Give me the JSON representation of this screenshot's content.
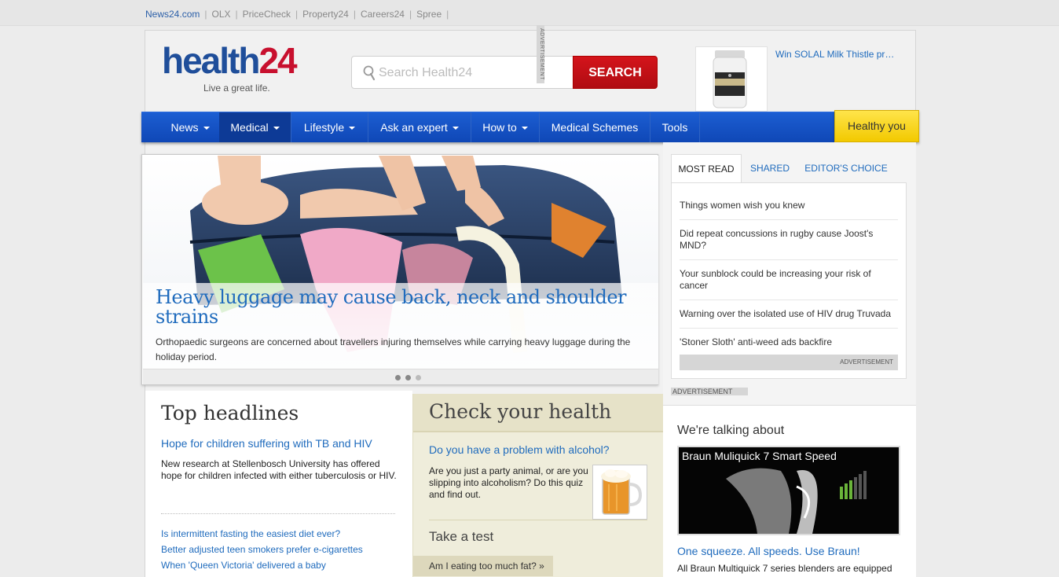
{
  "network": {
    "links": [
      "News24.com",
      "OLX",
      "PriceCheck",
      "Property24",
      "Careers24",
      "Spree"
    ]
  },
  "logo": {
    "word_a": "health",
    "word_b": "24",
    "tagline": "Live a great life."
  },
  "search": {
    "placeholder": "Search Health24",
    "button": "SEARCH"
  },
  "advertisement_tag": "ADVERTISEMENT",
  "top_ad": {
    "text": "Win SOLAL Milk Thistle pr…"
  },
  "nav": {
    "items": [
      {
        "label": "News",
        "dropdown": true
      },
      {
        "label": "Medical",
        "dropdown": true,
        "active": true
      },
      {
        "label": "Lifestyle",
        "dropdown": true
      },
      {
        "label": "Ask an expert",
        "dropdown": true
      },
      {
        "label": "How to",
        "dropdown": true
      },
      {
        "label": "Medical Schemes",
        "dropdown": false
      },
      {
        "label": "Tools",
        "dropdown": false
      }
    ],
    "featured": "Healthy you"
  },
  "hero": {
    "title": "Heavy luggage may cause back, neck and shoulder strains",
    "description": "Orthopaedic surgeons are concerned about travellers injuring themselves while carrying heavy luggage during the holiday period.",
    "slides": 3,
    "active_slide": 1
  },
  "most_read": {
    "tabs": [
      "MOST READ",
      "SHARED",
      "EDITOR'S CHOICE"
    ],
    "items": [
      "Things women wish you knew",
      "Did repeat concussions in rugby cause Joost's MND?",
      "Your sunblock could be increasing your risk of cancer",
      "Warning over the isolated use of HIV drug Truvada",
      "'Stoner Sloth' anti-weed ads backfire"
    ],
    "ad_label": "ADVERTISEMENT"
  },
  "sidebar_ad_label": "ADVERTISEMENT",
  "top_headlines": {
    "heading": "Top headlines",
    "lead_title": "Hope for children suffering with TB and HIV",
    "lead_text": "New research at Stellenbosch University has offered hope for children infected with either tuberculosis or HIV.",
    "links": [
      "Is intermittent fasting the easiest diet ever?",
      "Better adjusted teen smokers prefer e-cigarettes",
      "When 'Queen Victoria' delivered a baby"
    ]
  },
  "check_health": {
    "heading": "Check your health",
    "question": "Do you have a problem with alcohol?",
    "question_text": "Are you just a party animal, or are you slipping into alcoholism? Do this quiz and find out.",
    "test_heading": "Take a test",
    "test_link": "Am I eating too much fat? »"
  },
  "talking_about": {
    "heading": "We're talking about",
    "video_title": "Braun Muliquick 7 Smart Speed",
    "subtitle": "One squeeze. All speeds. Use Braun!",
    "text": "All Braun Multiquick 7 series blenders are equipped"
  },
  "colors": {
    "brand_blue": "#1f4e9a",
    "brand_red": "#c8102e",
    "nav_blue": "#1c5ed2",
    "link_blue": "#1f6bbd",
    "highlight_yellow": "#ffe44a"
  }
}
